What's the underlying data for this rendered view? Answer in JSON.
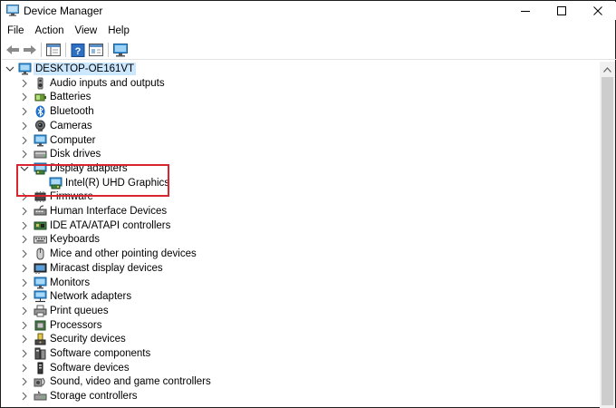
{
  "window": {
    "title": "Device Manager",
    "minimize_glyph": "—",
    "maximize_glyph": "☐",
    "close_glyph": "✕"
  },
  "menu": [
    "File",
    "Action",
    "View",
    "Help"
  ],
  "toolbar": {
    "buttons": [
      "back-arrow-icon",
      "forward-arrow-icon",
      "properties-icon",
      "help-icon",
      "console-tree-icon",
      "monitor-icon"
    ]
  },
  "tree": {
    "root": "DESKTOP-OE161VT",
    "categories": [
      {
        "label": "Audio inputs and outputs",
        "icon": "speaker-icon"
      },
      {
        "label": "Batteries",
        "icon": "battery-icon"
      },
      {
        "label": "Bluetooth",
        "icon": "bluetooth-icon"
      },
      {
        "label": "Cameras",
        "icon": "camera-icon"
      },
      {
        "label": "Computer",
        "icon": "computer-icon"
      },
      {
        "label": "Disk drives",
        "icon": "disk-drive-icon"
      },
      {
        "label": "Display adapters",
        "icon": "display-adapter-icon",
        "expanded": true,
        "children": [
          "Intel(R) UHD Graphics"
        ]
      },
      {
        "label": "Firmware",
        "icon": "firmware-icon"
      },
      {
        "label": "Human Interface Devices",
        "icon": "hid-icon"
      },
      {
        "label": "IDE ATA/ATAPI controllers",
        "icon": "ide-controller-icon"
      },
      {
        "label": "Keyboards",
        "icon": "keyboard-icon"
      },
      {
        "label": "Mice and other pointing devices",
        "icon": "mouse-icon"
      },
      {
        "label": "Miracast display devices",
        "icon": "miracast-icon"
      },
      {
        "label": "Monitors",
        "icon": "monitor-icon"
      },
      {
        "label": "Network adapters",
        "icon": "network-adapter-icon"
      },
      {
        "label": "Print queues",
        "icon": "printer-icon"
      },
      {
        "label": "Processors",
        "icon": "processor-icon"
      },
      {
        "label": "Security devices",
        "icon": "security-device-icon"
      },
      {
        "label": "Software components",
        "icon": "software-component-icon"
      },
      {
        "label": "Software devices",
        "icon": "software-device-icon"
      },
      {
        "label": "Sound, video and game controllers",
        "icon": "sound-controller-icon"
      },
      {
        "label": "Storage controllers",
        "icon": "storage-controller-icon"
      }
    ]
  },
  "colors": {
    "highlight_border": "#d9252f",
    "root_selection": "#cce8ff",
    "monitor_blue": "#2f8fd8"
  }
}
